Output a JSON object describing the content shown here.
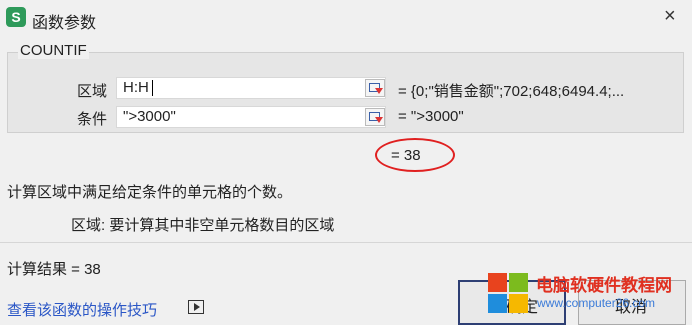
{
  "window": {
    "title": "函数参数",
    "app_icon": "S",
    "close": "×"
  },
  "function_name": "COUNTIF",
  "params": [
    {
      "label": "区域",
      "value": "H:H",
      "evaluated": "= {0;\"销售金额\";702;648;6494.4;..."
    },
    {
      "label": "条件",
      "value": "\">3000\"",
      "evaluated": "= \">3000\""
    }
  ],
  "result_preview": "= 38",
  "description": "计算区域中满足给定条件的单元格的个数。",
  "param_help": "区域:  要计算其中非空单元格数目的区域",
  "calc_result": "计算结果 = 38",
  "help_link": "查看该函数的操作技巧",
  "buttons": {
    "ok": "确定",
    "cancel": "取消"
  },
  "watermark": {
    "line1": "电脑软硬件教程网",
    "line2": "www.computer26.com"
  },
  "colors": {
    "highlight_oval": "#e02020",
    "link": "#2a56c6",
    "app_icon": "#2e9a5a"
  }
}
